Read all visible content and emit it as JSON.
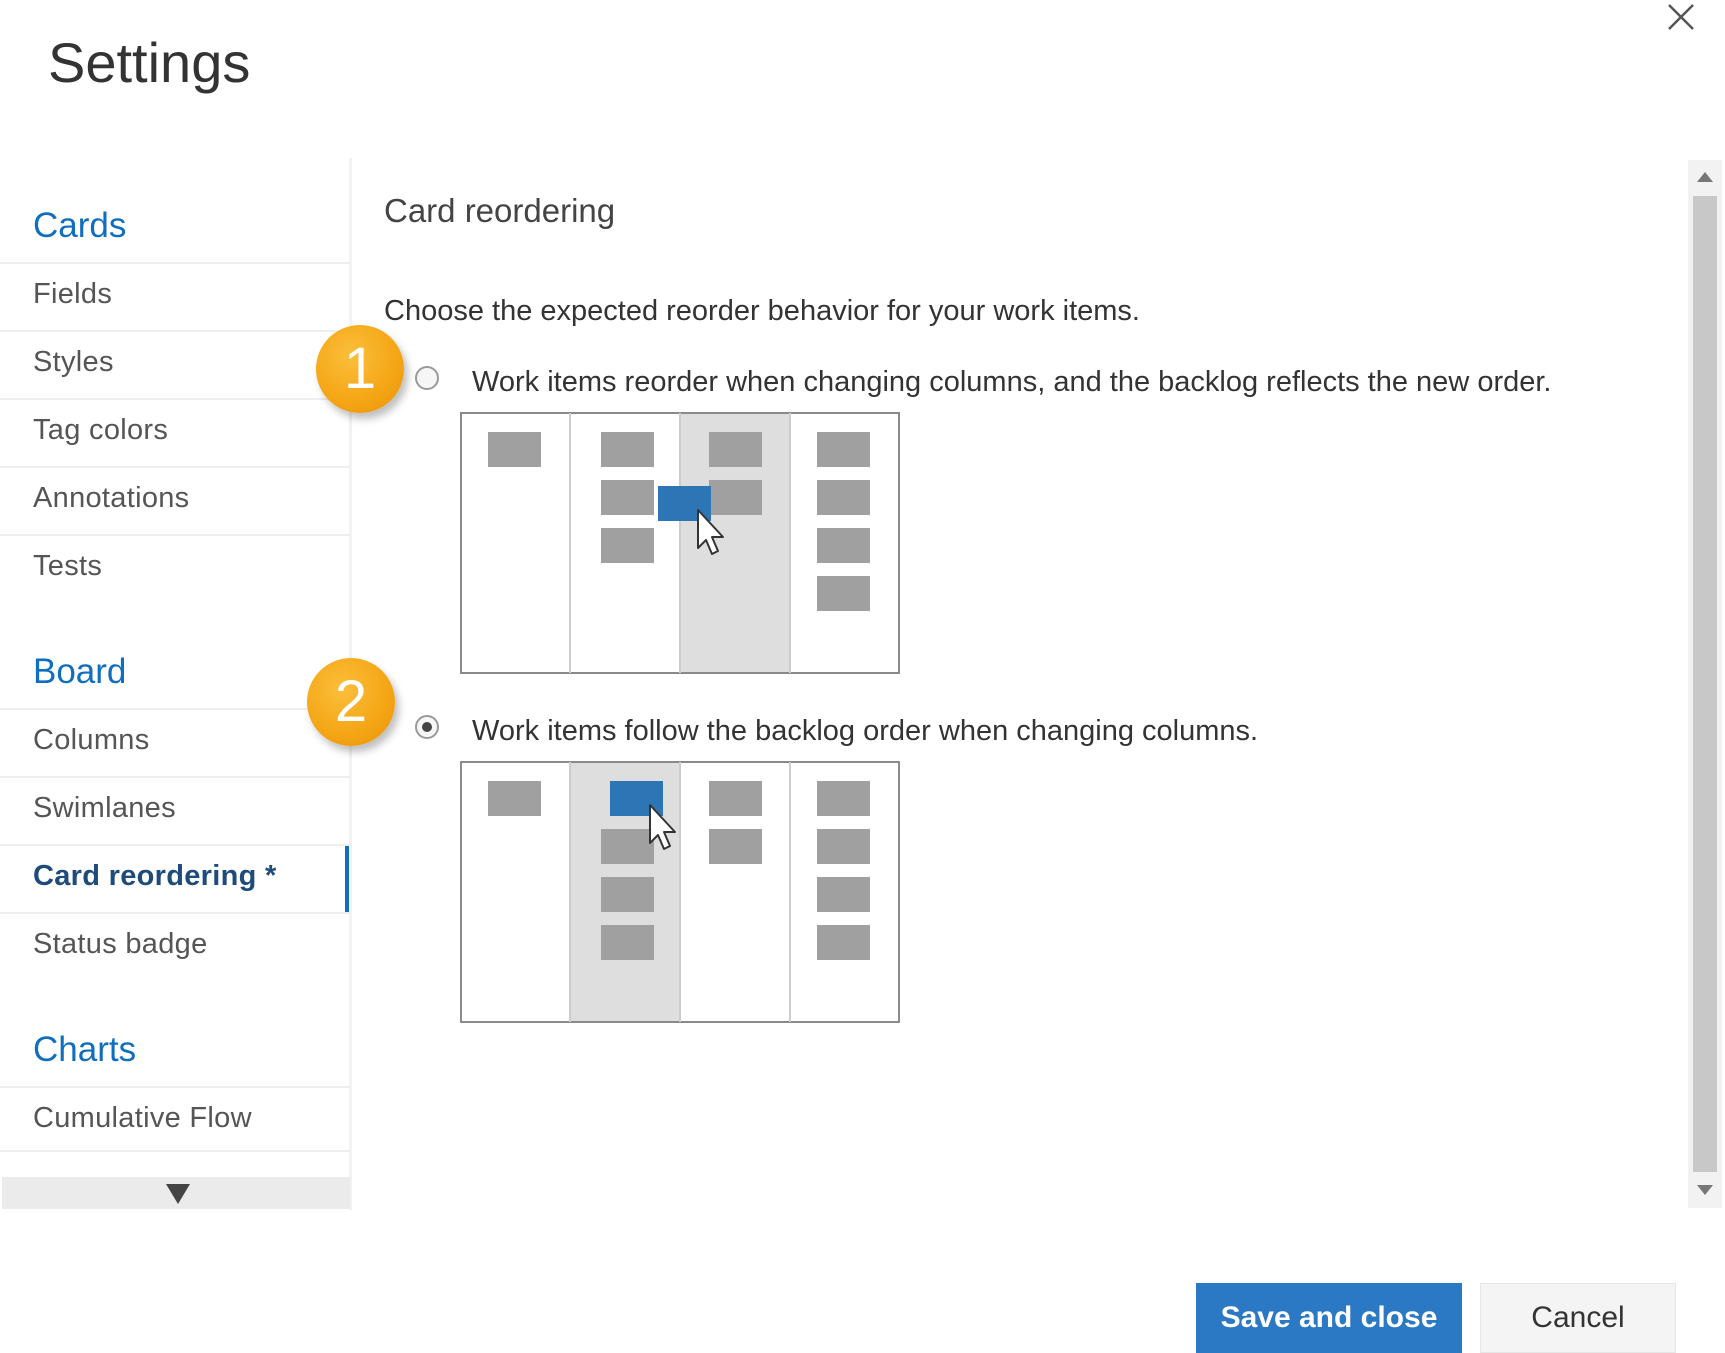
{
  "dialog": {
    "title": "Settings"
  },
  "sidebar": {
    "sections": [
      {
        "header": "Cards",
        "items": [
          {
            "label": "Fields",
            "selected": false
          },
          {
            "label": "Styles",
            "selected": false
          },
          {
            "label": "Tag colors",
            "selected": false
          },
          {
            "label": "Annotations",
            "selected": false
          },
          {
            "label": "Tests",
            "selected": false
          }
        ]
      },
      {
        "header": "Board",
        "items": [
          {
            "label": "Columns",
            "selected": false
          },
          {
            "label": "Swimlanes",
            "selected": false
          },
          {
            "label": "Card reordering *",
            "selected": true
          },
          {
            "label": "Status badge",
            "selected": false
          }
        ]
      },
      {
        "header": "Charts",
        "items": [
          {
            "label": "Cumulative Flow",
            "selected": false
          }
        ]
      }
    ]
  },
  "main": {
    "heading": "Card reordering",
    "description": "Choose the expected reorder behavior for your work items.",
    "options": [
      {
        "badge": "1",
        "label": "Work items reorder when changing columns, and the backlog reflects the new order.",
        "checked": false
      },
      {
        "badge": "2",
        "label": "Work items follow the backlog order when changing columns.",
        "checked": true
      }
    ]
  },
  "footer": {
    "save_label": "Save and close",
    "cancel_label": "Cancel"
  },
  "icons": {
    "close": "close-icon",
    "cursor": "mouse-pointer-icon",
    "scroll_up": "chevron-up-icon",
    "scroll_down": "chevron-down-icon"
  },
  "colors": {
    "accent": "#106ebe",
    "primary_button": "#2b78c5",
    "badge": "#f4a514",
    "card": "#a0a0a0",
    "dragged_card": "#2e75b6",
    "highlight_column": "#dedede"
  }
}
